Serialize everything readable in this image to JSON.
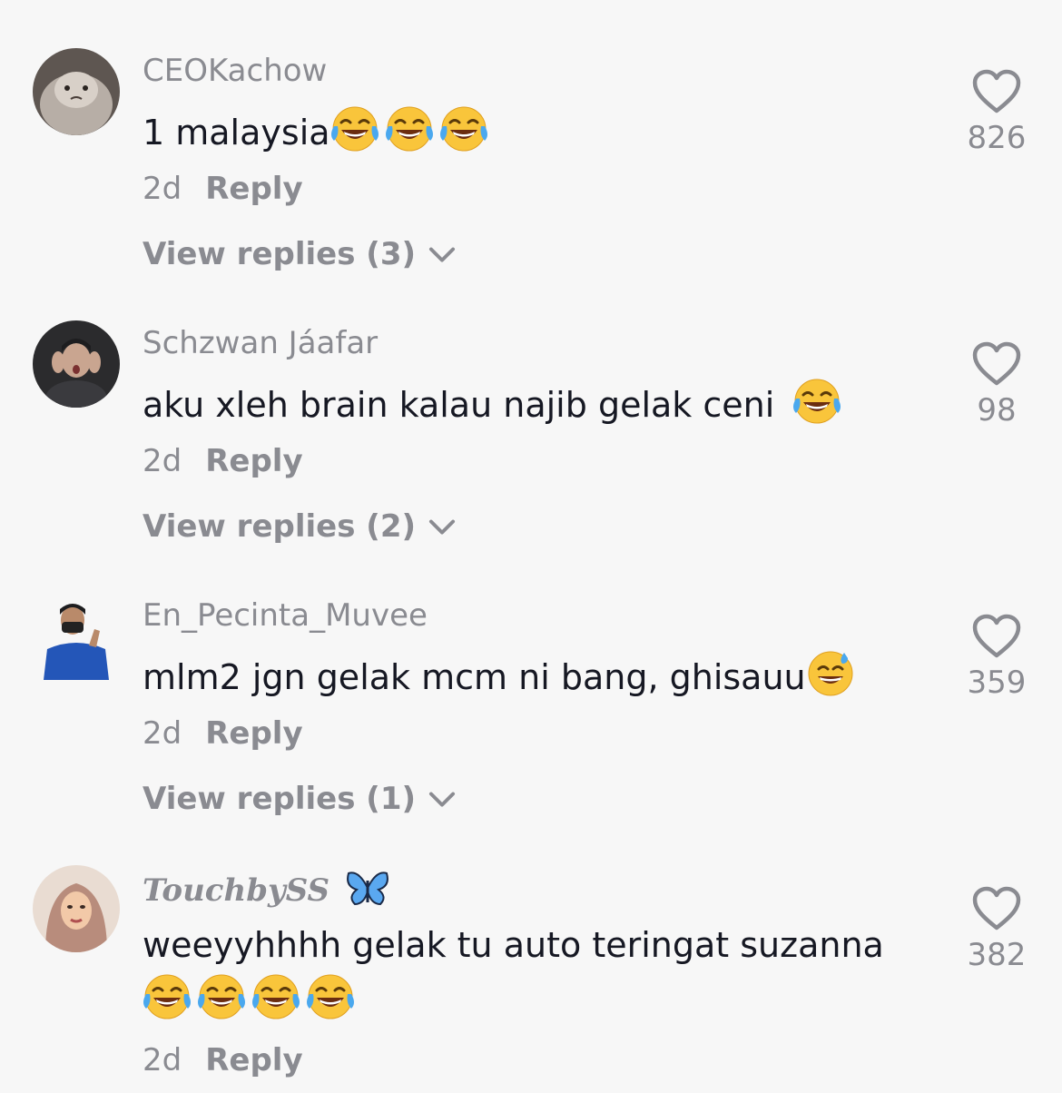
{
  "comments": [
    {
      "username": "CEOKachow",
      "text_lines": [
        "1 malaysia"
      ],
      "emojis": [
        "tears-of-joy",
        "tears-of-joy",
        "tears-of-joy"
      ],
      "time": "2d",
      "reply_label": "Reply",
      "view_replies": "View replies (3)",
      "likes": "826"
    },
    {
      "username": "Schzwan Jáafar",
      "text_lines": [
        "aku xleh brain kalau najib gelak ceni "
      ],
      "emojis": [
        "tears-of-joy"
      ],
      "time": "2d",
      "reply_label": "Reply",
      "view_replies": "View replies (2)",
      "likes": "98"
    },
    {
      "username": "En_Pecinta_Muvee",
      "text_lines": [
        "mlm2 jgn gelak mcm ni bang, ghisauu"
      ],
      "emojis": [
        "grinning-sweat"
      ],
      "time": "2d",
      "reply_label": "Reply",
      "view_replies": "View replies (1)",
      "likes": "359"
    },
    {
      "username": "TouchbySS",
      "username_badge": "butterfly-icon",
      "text_lines": [
        "weeyyhhhh gelak tu auto teringat suzanna"
      ],
      "emojis": [
        "tears-of-joy",
        "tears-of-joy",
        "tears-of-joy",
        "tears-of-joy"
      ],
      "time": "2d",
      "reply_label": "Reply",
      "likes": "382"
    }
  ],
  "colors": {
    "background": "#f7f7f7",
    "text_primary": "#161823",
    "text_secondary": "#8a8b91"
  }
}
